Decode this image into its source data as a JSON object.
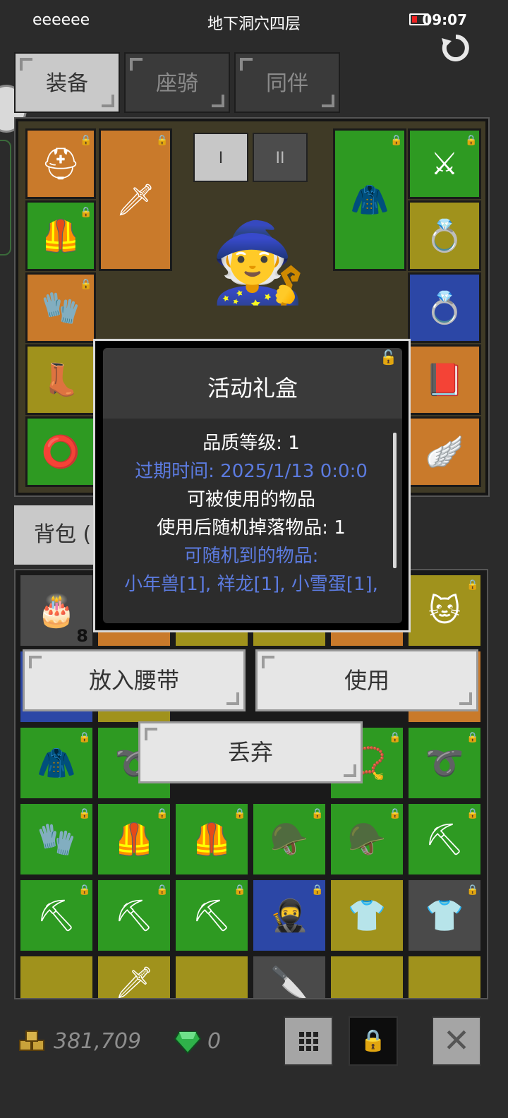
{
  "status_bar": {
    "left_text": "eeeeee",
    "title": "地下洞穴四层",
    "time": "09:07"
  },
  "tabs": [
    {
      "label": "装备",
      "active": true
    },
    {
      "label": "座骑",
      "active": false
    },
    {
      "label": "同伴",
      "active": false
    }
  ],
  "equip_controls": {
    "button1": "I",
    "button2": "II"
  },
  "bag_tab": {
    "label": "背包 ("
  },
  "modal": {
    "title": "活动礼盒",
    "lines": [
      {
        "text": "品质等级: 1",
        "color": "white"
      },
      {
        "text": "过期时间: 2025/1/13 0:0:0",
        "color": "blue"
      },
      {
        "text": "可被使用的物品",
        "color": "white"
      },
      {
        "text": "使用后随机掉落物品: 1",
        "color": "white"
      },
      {
        "text": "可随机到的物品:",
        "color": "blue"
      },
      {
        "text": "小年兽[1], 祥龙[1], 小雪蛋[1],",
        "color": "blue"
      }
    ]
  },
  "actions": {
    "belt_label": "放入腰带",
    "use_label": "使用",
    "discard_label": "丢弃"
  },
  "inventory": {
    "first_item_count": "8"
  },
  "currency": {
    "gold": "381,709",
    "gems": "0"
  },
  "colors": {
    "quality_orange": "#c97a2b",
    "quality_green": "#2e9a22",
    "quality_yellow": "#a0921c",
    "quality_blue": "#2c47a6",
    "text_blue": "#5c7be0"
  },
  "icons": [
    "refresh-icon",
    "battery-icon",
    "gold-icon",
    "gem-icon",
    "grid-icon",
    "lock-icon",
    "close-icon"
  ]
}
